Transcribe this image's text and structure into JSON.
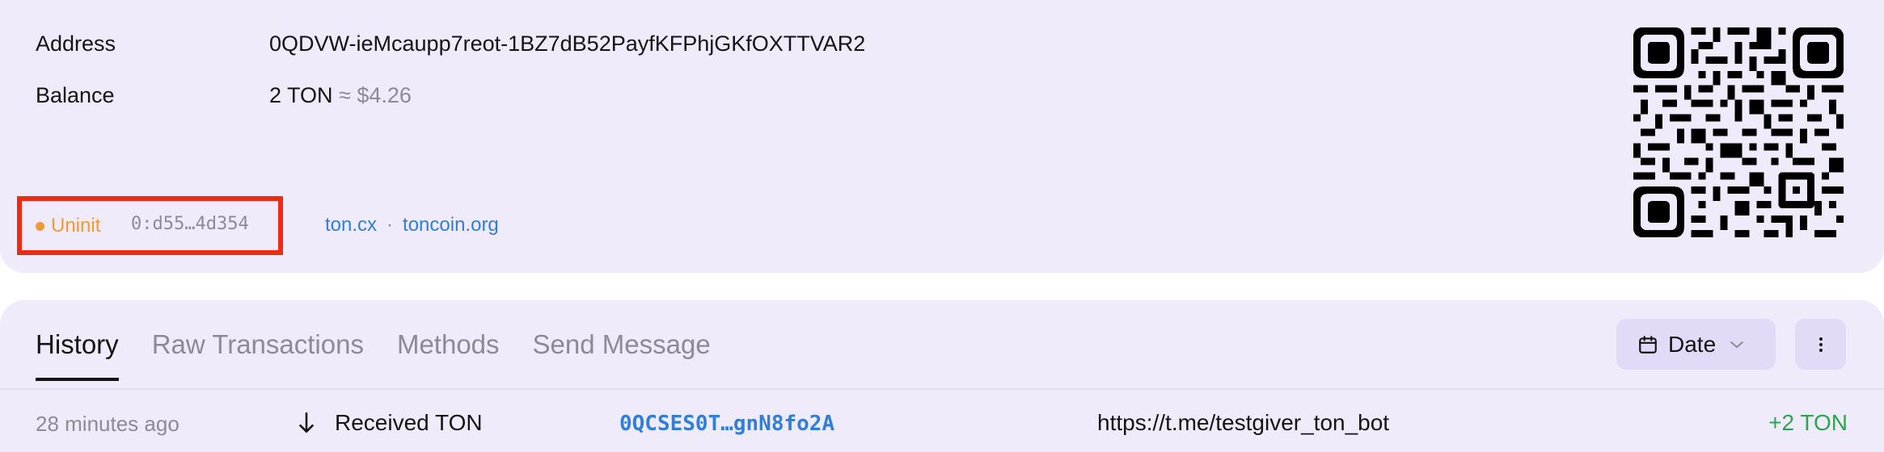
{
  "account": {
    "address_label": "Address",
    "address_value": "0QDVW-ieMcaupp7reot-1BZ7dB52PayfKFPhjGKfOXTTVAR2",
    "balance_label": "Balance",
    "balance_value": "2 TON",
    "balance_fiat": "≈ $4.26",
    "status": "Uninit",
    "raw_address": "0:d55…4d354",
    "links": [
      "ton.cx",
      "toncoin.org"
    ],
    "link_separator": "·"
  },
  "tabs": [
    {
      "label": "History",
      "active": true
    },
    {
      "label": "Raw Transactions",
      "active": false
    },
    {
      "label": "Methods",
      "active": false
    },
    {
      "label": "Send Message",
      "active": false
    }
  ],
  "filters": {
    "date_label": "Date",
    "date_icon": "calendar-icon",
    "more_icon": "more-vertical-icon"
  },
  "transactions": [
    {
      "time": "28 minutes ago",
      "direction_icon": "arrow-down-icon",
      "type": "Received TON",
      "address": "0QCSES0T…gnN8fo2A",
      "comment": "https://t.me/testgiver_ton_bot",
      "amount": "+2 TON"
    }
  ],
  "colors": {
    "card_bg": "#efebfb",
    "status_uninit": "#f09a35",
    "link": "#2f7ed8",
    "positive": "#29a74e",
    "highlight": "#ee2a12"
  }
}
